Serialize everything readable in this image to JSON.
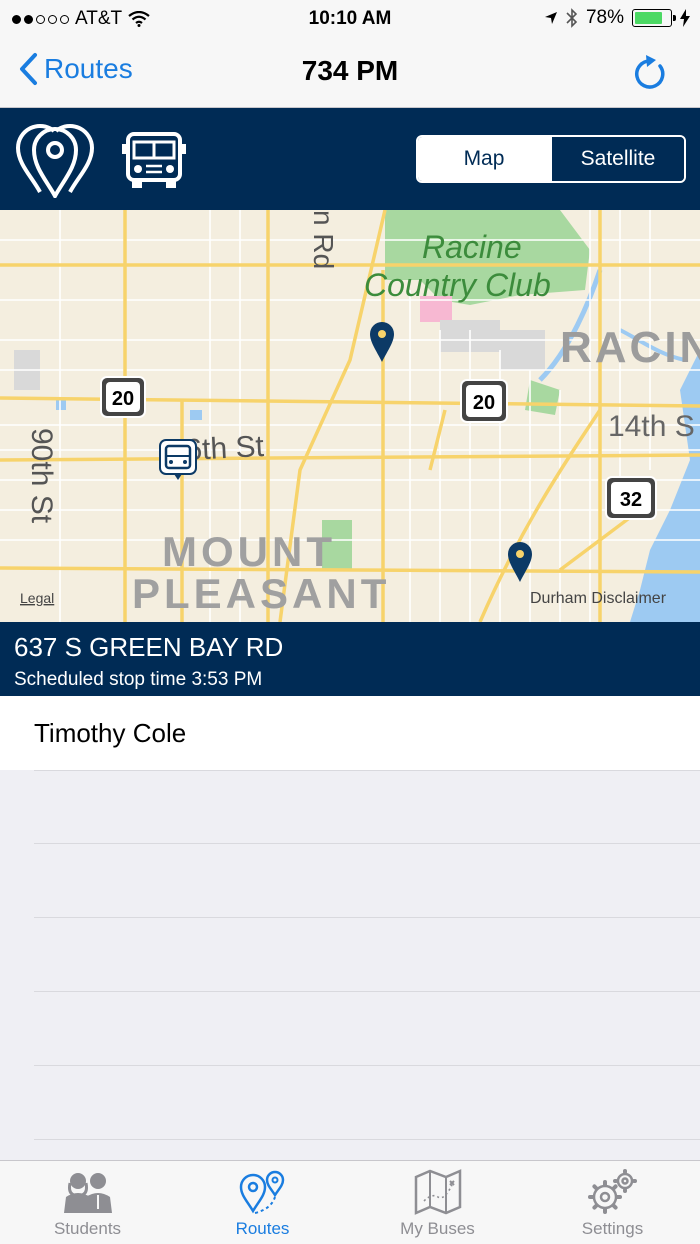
{
  "status_bar": {
    "carrier": "AT&T",
    "time": "10:10 AM",
    "battery_percent": "78%",
    "battery_level": 0.78,
    "signal_bars_filled": 2,
    "signal_bars_total": 5
  },
  "nav": {
    "back_label": "Routes",
    "title": "734 PM"
  },
  "toolbar": {
    "segments": [
      {
        "label": "Map",
        "selected": true
      },
      {
        "label": "Satellite",
        "selected": false
      }
    ]
  },
  "map": {
    "labels": {
      "club_1": "Racine",
      "club_2": "Country Club",
      "city": "RACIN",
      "street_14th": "14th S",
      "street_16th": "6th St",
      "street_90th": "90th St",
      "street_rd": "n Rd",
      "mount": "MOUNT",
      "pleasant": "PLEASANT",
      "legal": "Legal",
      "disclaimer": "Durham Disclaimer"
    },
    "shields": {
      "hwy_a": "20",
      "hwy_b": "20",
      "hwy_c": "32"
    }
  },
  "stop": {
    "address": "637 S GREEN BAY RD",
    "scheduled": "Scheduled stop time 3:53 PM"
  },
  "students": [
    {
      "name": "Timothy Cole"
    }
  ],
  "tabs": [
    {
      "label": "Students",
      "icon": "students-icon",
      "active": false
    },
    {
      "label": "Routes",
      "icon": "routes-icon",
      "active": true
    },
    {
      "label": "My Buses",
      "icon": "map-icon",
      "active": false
    },
    {
      "label": "Settings",
      "icon": "gear-icon",
      "active": false
    }
  ],
  "colors": {
    "accent": "#1a7de0",
    "navy": "#002b55",
    "battery": "#4cd964"
  }
}
